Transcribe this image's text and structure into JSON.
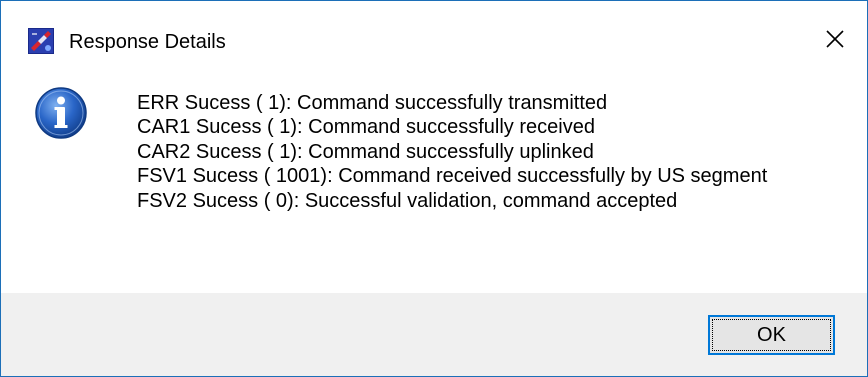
{
  "window": {
    "title": "Response Details",
    "app_icon": "satellite-app-icon",
    "close_icon": "close-icon"
  },
  "content": {
    "icon": "information-icon",
    "messages": [
      "ERR Sucess ( 1): Command successfully transmitted",
      "CAR1 Sucess ( 1): Command successfully received",
      "CAR2 Sucess ( 1): Command successfully uplinked",
      "FSV1 Sucess ( 1001): Command received successfully by US segment",
      "FSV2 Sucess ( 0): Successful validation, command accepted"
    ]
  },
  "footer": {
    "ok_label": "OK"
  },
  "colors": {
    "window_border": "#1c6fb8",
    "footer_bg": "#f0f0f0",
    "button_focus_border": "#0078d7",
    "info_icon_blue": "#1f5fbf"
  }
}
